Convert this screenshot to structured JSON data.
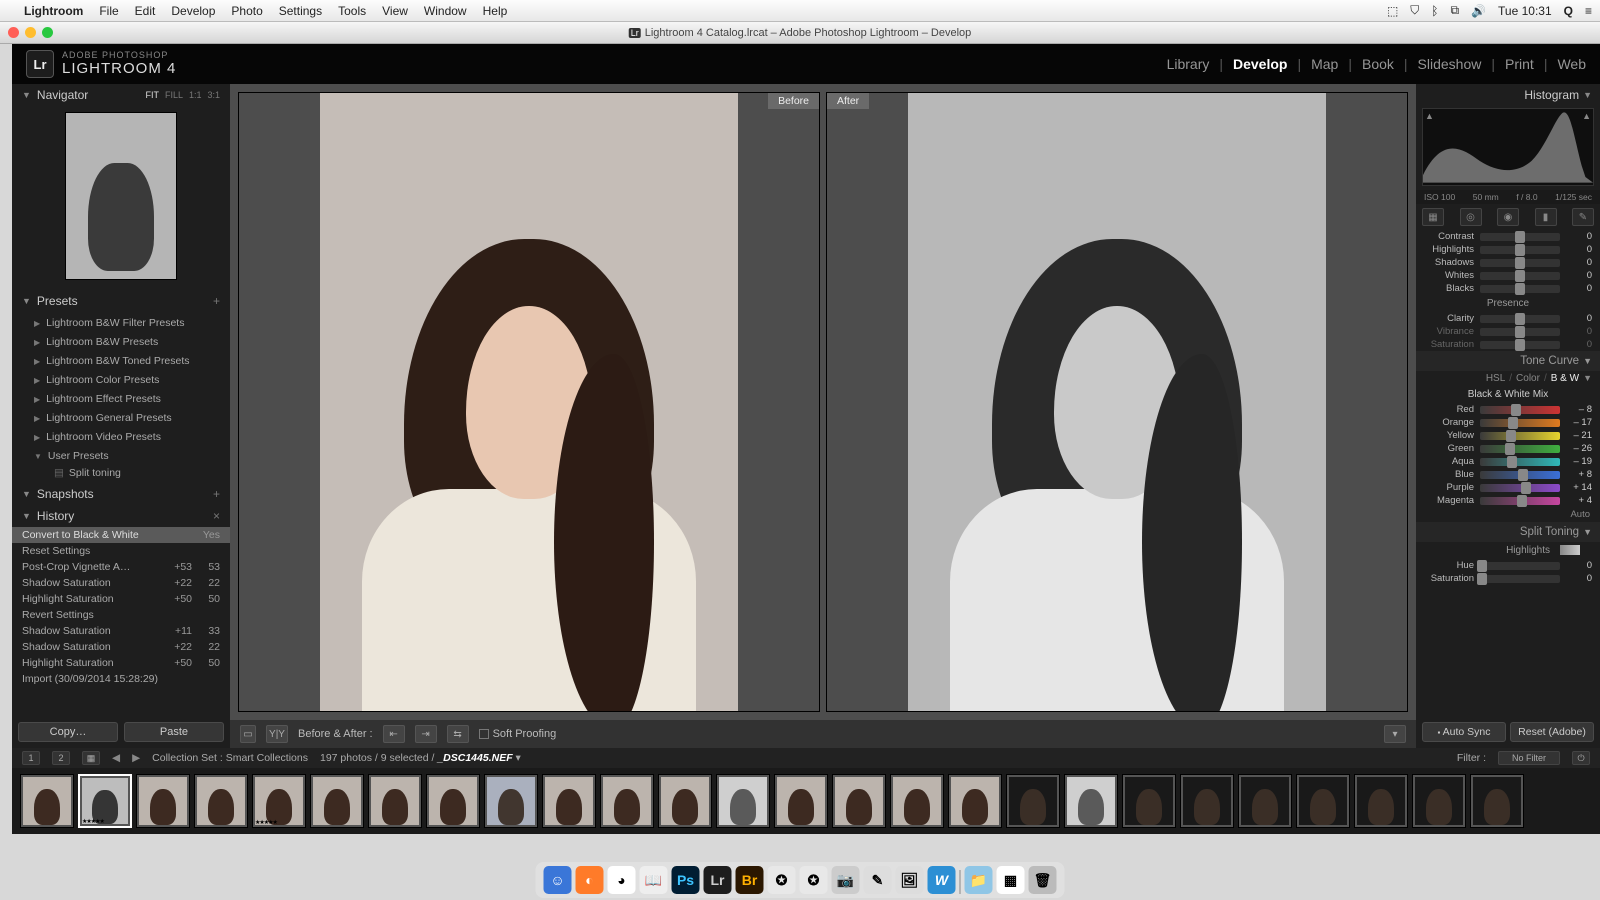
{
  "menubar": {
    "app": "Lightroom",
    "items": [
      "File",
      "Edit",
      "Develop",
      "Photo",
      "Settings",
      "Tools",
      "View",
      "Window",
      "Help"
    ],
    "right": {
      "clock": "Tue 10:31"
    }
  },
  "window_title": "Lightroom 4 Catalog.lrcat – Adobe Photoshop Lightroom – Develop",
  "brand": {
    "sup": "ADOBE PHOTOSHOP",
    "name": "LIGHTROOM 4"
  },
  "modules": [
    "Library",
    "Develop",
    "Map",
    "Book",
    "Slideshow",
    "Print",
    "Web"
  ],
  "modules_active": "Develop",
  "left": {
    "navigator": {
      "title": "Navigator",
      "modes": [
        "FIT",
        "FILL",
        "1:1",
        "3:1"
      ],
      "mode_active": "FIT"
    },
    "presets": {
      "title": "Presets",
      "groups": [
        "Lightroom B&W Filter Presets",
        "Lightroom B&W Presets",
        "Lightroom B&W Toned Presets",
        "Lightroom Color Presets",
        "Lightroom Effect Presets",
        "Lightroom General Presets",
        "Lightroom Video Presets",
        "User Presets"
      ],
      "user_item": "Split toning"
    },
    "snapshots": {
      "title": "Snapshots"
    },
    "history": {
      "title": "History",
      "rows": [
        {
          "lbl": "Convert to Black & White",
          "a": "",
          "b": "Yes",
          "sel": true
        },
        {
          "lbl": "Reset Settings",
          "a": "",
          "b": ""
        },
        {
          "lbl": "Post-Crop Vignette A…",
          "a": "+53",
          "b": "53"
        },
        {
          "lbl": "Shadow Saturation",
          "a": "+22",
          "b": "22"
        },
        {
          "lbl": "Highlight Saturation",
          "a": "+50",
          "b": "50"
        },
        {
          "lbl": "Revert Settings",
          "a": "",
          "b": ""
        },
        {
          "lbl": "Shadow Saturation",
          "a": "+11",
          "b": "33"
        },
        {
          "lbl": "Shadow Saturation",
          "a": "+22",
          "b": "22"
        },
        {
          "lbl": "Highlight Saturation",
          "a": "+50",
          "b": "50"
        },
        {
          "lbl": "Import (30/09/2014 15:28:29)",
          "a": "",
          "b": ""
        }
      ]
    },
    "copy": "Copy…",
    "paste": "Paste"
  },
  "center": {
    "before": "Before",
    "after": "After",
    "toolbar": {
      "before_after": "Before & After :",
      "soft_proof": "Soft Proofing"
    }
  },
  "right": {
    "histogram": "Histogram",
    "meta": {
      "iso": "ISO 100",
      "focal": "50 mm",
      "aperture": "f / 8.0",
      "shutter": "1/125 sec"
    },
    "basic": {
      "sliders": [
        {
          "lbl": "Contrast",
          "val": "0",
          "dim": false
        },
        {
          "lbl": "Highlights",
          "val": "0",
          "dim": false
        },
        {
          "lbl": "Shadows",
          "val": "0",
          "dim": false
        },
        {
          "lbl": "Whites",
          "val": "0",
          "dim": false
        },
        {
          "lbl": "Blacks",
          "val": "0",
          "dim": false
        }
      ],
      "presence": "Presence",
      "presence_s": [
        {
          "lbl": "Clarity",
          "val": "0",
          "dim": false
        },
        {
          "lbl": "Vibrance",
          "val": "0",
          "dim": true
        },
        {
          "lbl": "Saturation",
          "val": "0",
          "dim": true
        }
      ]
    },
    "tone_curve": "Tone Curve",
    "hsl_bar": {
      "hsl": "HSL",
      "color": "Color",
      "bw": "B & W"
    },
    "bw_mix_title": "Black & White Mix",
    "bw_mix": [
      {
        "lbl": "Red",
        "val": "– 8",
        "p": 45,
        "grad": "grad-red"
      },
      {
        "lbl": "Orange",
        "val": "– 17",
        "p": 41,
        "grad": "grad-orange"
      },
      {
        "lbl": "Yellow",
        "val": "– 21",
        "p": 39,
        "grad": "grad-yellow"
      },
      {
        "lbl": "Green",
        "val": "– 26",
        "p": 37,
        "grad": "grad-green"
      },
      {
        "lbl": "Aqua",
        "val": "– 19",
        "p": 40,
        "grad": "grad-aqua"
      },
      {
        "lbl": "Blue",
        "val": "+ 8",
        "p": 54,
        "grad": "grad-blue"
      },
      {
        "lbl": "Purple",
        "val": "+ 14",
        "p": 57,
        "grad": "grad-purple"
      },
      {
        "lbl": "Magenta",
        "val": "+ 4",
        "p": 52,
        "grad": "grad-magenta"
      }
    ],
    "auto": "Auto",
    "split_toning": "Split Toning",
    "split": {
      "highlights": "Highlights",
      "hue": "Hue",
      "sat": "Saturation",
      "hue_v": "0",
      "sat_v": "0"
    },
    "buttons": {
      "sync": "Auto Sync",
      "reset": "Reset (Adobe)"
    }
  },
  "info": {
    "collection": "Collection Set : Smart Collections",
    "count": "197 photos / 9 selected /",
    "filename": "_DSC1445.NEF",
    "filter_lbl": "Filter :",
    "filter_val": "No Filter"
  },
  "dock": [
    "Finder",
    "Firefox",
    "Chrome",
    "Dict",
    "Ps",
    "Lr",
    "Br",
    "Safari",
    "Safari2",
    "Cam",
    "Notes",
    "Prev",
    "W",
    "Folder",
    "Cal",
    "Trash"
  ]
}
